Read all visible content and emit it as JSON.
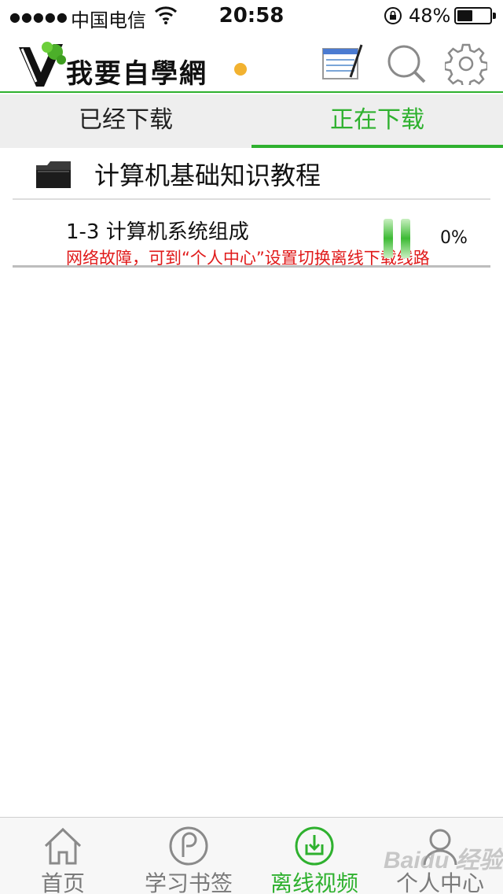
{
  "status_bar": {
    "signal": "●●●●●",
    "carrier": "中国电信",
    "time": "20:58",
    "battery_text": "48%",
    "battery_level": 0.48,
    "icons": [
      "wifi-icon",
      "orientation-lock-icon",
      "battery-icon"
    ]
  },
  "header": {
    "logo_text": "我要自學網",
    "buttons": [
      "notes-icon",
      "search-icon",
      "settings-icon"
    ]
  },
  "tabs": {
    "downloaded": "已经下载",
    "downloading": "正在下载",
    "active": "downloading"
  },
  "course": {
    "title": "计算机基础知识教程"
  },
  "downloads": [
    {
      "title": "1-3 计算机系统组成",
      "error": "网络故障，可到“个人中心”设置切换离线下载线路",
      "progress": "0%"
    }
  ],
  "bottom_nav": [
    {
      "label": "首页",
      "icon": "home-icon"
    },
    {
      "label": "学习书签",
      "icon": "bookmark-icon"
    },
    {
      "label": "离线视频",
      "icon": "download-icon",
      "active": true
    },
    {
      "label": "个人中心",
      "icon": "user-icon"
    }
  ],
  "watermark": "Baidu 经验",
  "colors": {
    "accent": "#2fb12f",
    "error": "#e01a1a",
    "tab_bg": "#eeeeee"
  }
}
